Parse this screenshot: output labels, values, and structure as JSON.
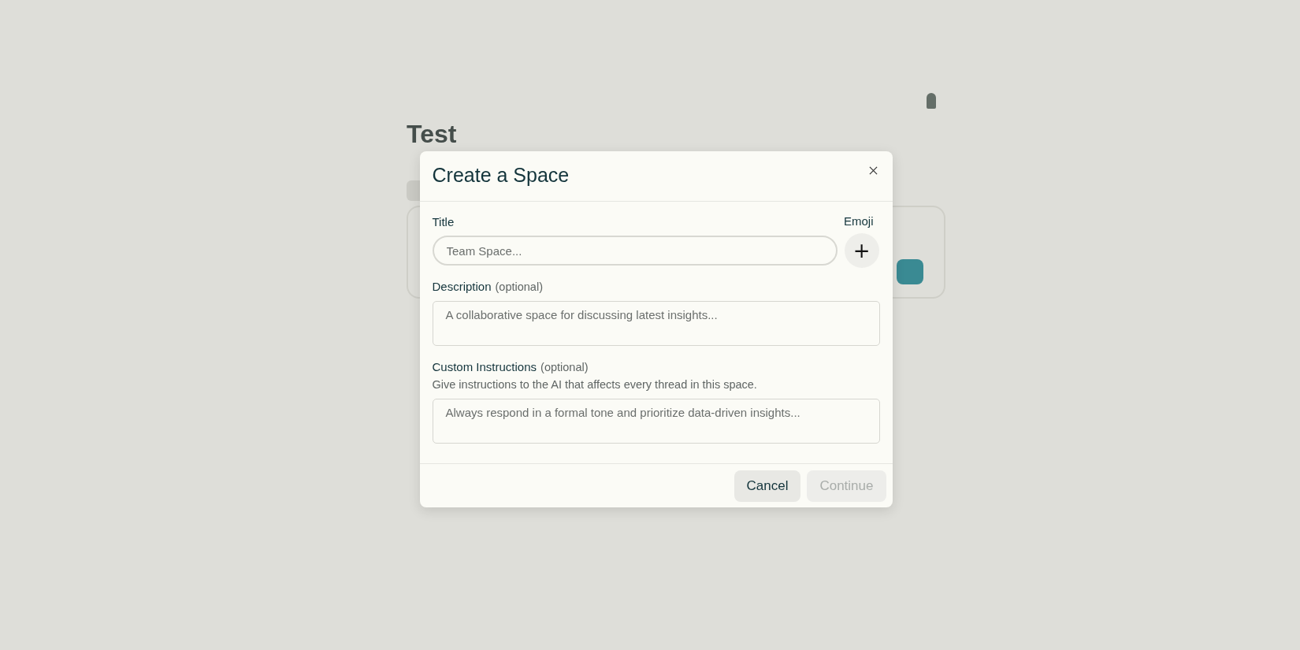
{
  "background_page": {
    "title": "Test"
  },
  "dialog": {
    "title": "Create a Space",
    "title_field": {
      "label": "Title",
      "placeholder": "Team Space..."
    },
    "emoji": {
      "label": "Emoji",
      "button": "+"
    },
    "description_field": {
      "label": "Description",
      "hint": "(optional)",
      "placeholder": "A collaborative space for discussing latest insights..."
    },
    "instructions_field": {
      "label": "Custom Instructions",
      "hint": "(optional)",
      "help": "Give instructions to the AI that affects every thread in this space.",
      "placeholder": "Always respond in a formal tone and prioritize data-driven insights..."
    },
    "buttons": [
      {
        "label": "Cancel",
        "disabled": false
      },
      {
        "label": "Continue",
        "disabled": true
      }
    ]
  }
}
